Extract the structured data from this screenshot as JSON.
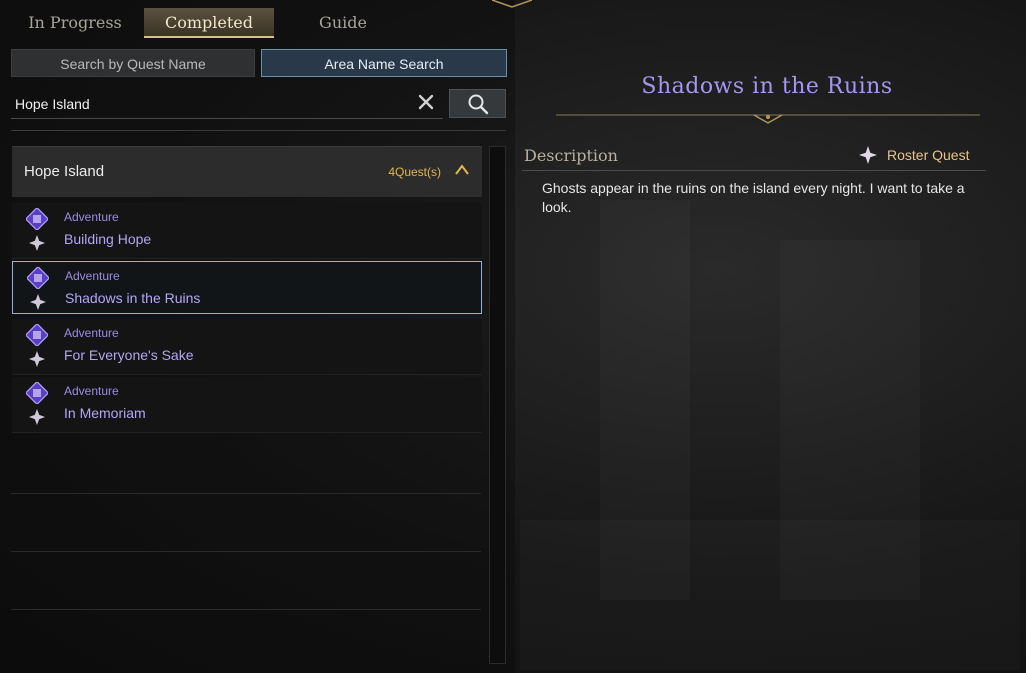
{
  "tabs": [
    {
      "label": "In Progress",
      "active": false
    },
    {
      "label": "Completed",
      "active": true
    },
    {
      "label": "Guide",
      "active": false
    }
  ],
  "search_modes": {
    "quest_name_label": "Search by Quest Name",
    "area_name_label": "Area Name Search",
    "selected": "Area Name Search"
  },
  "search": {
    "value": "Hope Island",
    "clear_icon": "close-icon",
    "search_icon": "search-icon"
  },
  "group": {
    "name": "Hope Island",
    "count": "4Quest(s)",
    "collapse_icon": "chevron-up-icon"
  },
  "quests": [
    {
      "type": "Adventure",
      "title": "Building Hope",
      "selected": false
    },
    {
      "type": "Adventure",
      "title": "Shadows in the Ruins",
      "selected": true
    },
    {
      "type": "Adventure",
      "title": "For Everyone's Sake",
      "selected": false
    },
    {
      "type": "Adventure",
      "title": "In Memoriam",
      "selected": false
    }
  ],
  "detail": {
    "title": "Shadows in the Ruins",
    "description_label": "Description",
    "roster_label": "Roster Quest",
    "description": "Ghosts appear in the ruins on the island every night. I want to take a look."
  },
  "colors": {
    "accent_purple": "#a696f0",
    "count_gold": "#e3b64f",
    "roster_gold": "#e8c48a",
    "selected_border": "#8fb4d8"
  }
}
